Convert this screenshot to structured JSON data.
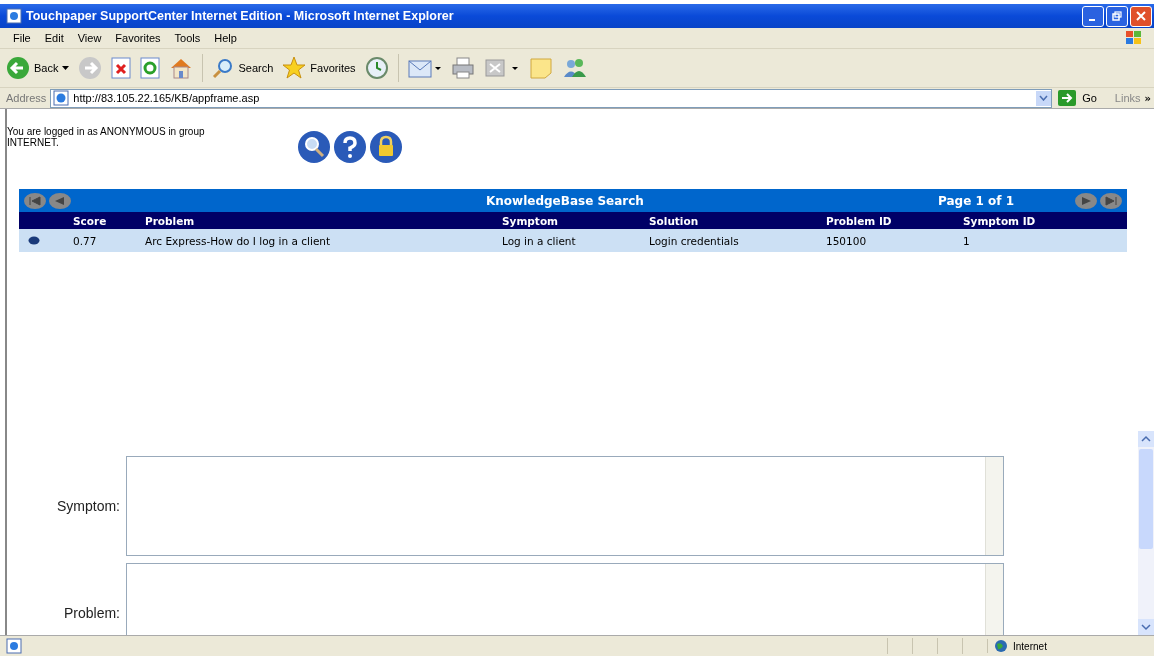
{
  "window": {
    "title": "Touchpaper SupportCenter Internet Edition - Microsoft Internet Explorer"
  },
  "menu": [
    "File",
    "Edit",
    "View",
    "Favorites",
    "Tools",
    "Help"
  ],
  "toolbar": {
    "back": "Back",
    "search": "Search",
    "favorites": "Favorites"
  },
  "address_bar": {
    "label": "Address",
    "url": "http://83.105.22.165/KB/appframe.asp",
    "go": "Go",
    "links": "Links",
    "more": "»"
  },
  "login_text": "You are logged in as ANONYMOUS in group INTERNET.",
  "results": {
    "title": "KnowledgeBase Search",
    "page": "Page 1 of 1",
    "columns": [
      "Score",
      "Problem",
      "Symptom",
      "Solution",
      "Problem ID",
      "Symptom ID"
    ],
    "rows": [
      {
        "cells": [
          "0.77",
          "Arc Express-How do I log in a client",
          "Log in a client",
          "Login credentials",
          "150100",
          "1"
        ]
      }
    ]
  },
  "fields": [
    {
      "label": "Symptom:"
    },
    {
      "label": "Problem:"
    }
  ],
  "status_bar": {
    "zone": "Internet"
  }
}
